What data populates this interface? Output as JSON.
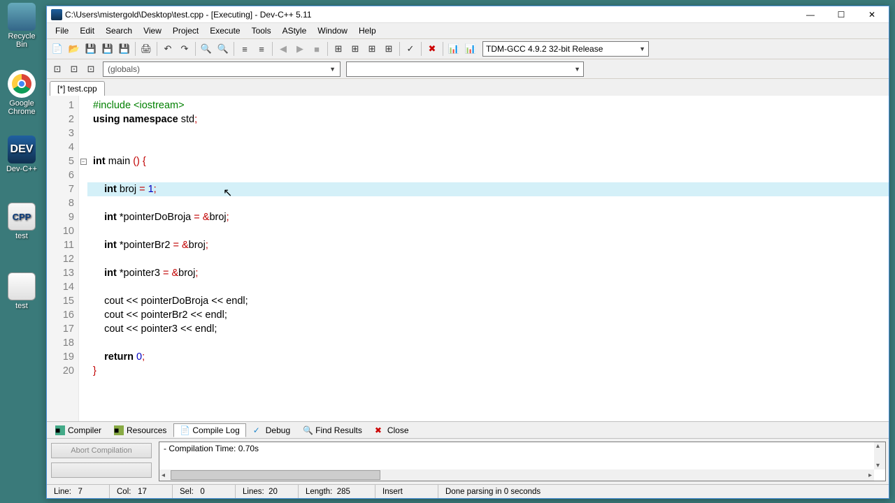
{
  "desktop": {
    "recycle": "Recycle Bin",
    "chrome": "Google Chrome",
    "devc": "Dev-C++",
    "test_cpp": "test",
    "test_exe": "test"
  },
  "window": {
    "title": "C:\\Users\\mistergold\\Desktop\\test.cpp - [Executing] - Dev-C++ 5.11"
  },
  "menu": {
    "file": "File",
    "edit": "Edit",
    "search": "Search",
    "view": "View",
    "project": "Project",
    "execute": "Execute",
    "tools": "Tools",
    "astyle": "AStyle",
    "window": "Window",
    "help": "Help"
  },
  "toolbar": {
    "compiler_selected": "TDM-GCC 4.9.2 32-bit Release",
    "globals": "(globals)"
  },
  "tab": {
    "label": "[*] test.cpp"
  },
  "code": {
    "lines": 20,
    "l1a": "#include",
    "l1b": " <iostream>",
    "l2a": "using ",
    "l2b": "namespace ",
    "l2c": "std",
    "l5a": "int ",
    "l5b": "main ",
    "l5c": "() {",
    "l7a": "int ",
    "l7b": "broj ",
    "l7c": "= ",
    "l7d": "1",
    "l9a": "int ",
    "l9b": "*pointerDoBroja ",
    "l9c": "= &",
    "l9d": "broj",
    "l11a": "int ",
    "l11b": "*pointerBr2 ",
    "l11c": "= &",
    "l11d": "broj",
    "l13a": "int ",
    "l13b": "*pointer3 ",
    "l13c": "= &",
    "l13d": "broj",
    "l15": "    cout << pointerDoBroja << endl;",
    "l16": "    cout << pointerBr2 << endl;",
    "l17": "    cout << pointer3 << endl;",
    "l19a": "return ",
    "l19b": "0",
    "l20": "}"
  },
  "bottom_tabs": {
    "compiler": "Compiler",
    "resources": "Resources",
    "compile_log": "Compile Log",
    "debug": "Debug",
    "find_results": "Find Results",
    "close": "Close"
  },
  "panel": {
    "abort": "Abort Compilation",
    "log": "- Compilation Time: 0.70s"
  },
  "status": {
    "line_lbl": "Line:",
    "line_val": "7",
    "col_lbl": "Col:",
    "col_val": "17",
    "sel_lbl": "Sel:",
    "sel_val": "0",
    "lines_lbl": "Lines:",
    "lines_val": "20",
    "length_lbl": "Length:",
    "length_val": "285",
    "mode": "Insert",
    "msg": "Done parsing in 0 seconds"
  },
  "chart_data": {
    "type": "table",
    "note": "no chart in image"
  }
}
